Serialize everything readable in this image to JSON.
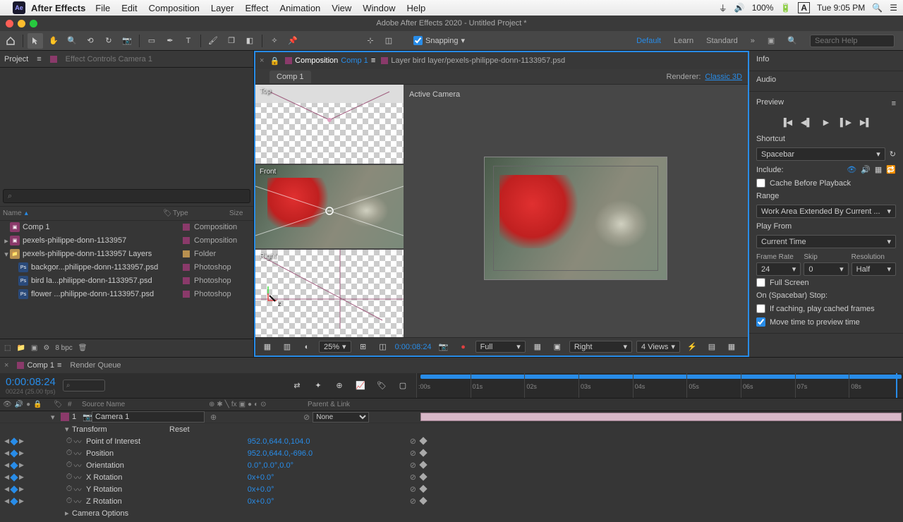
{
  "mac": {
    "app": "After Effects",
    "menus": [
      "File",
      "Edit",
      "Composition",
      "Layer",
      "Effect",
      "Animation",
      "View",
      "Window",
      "Help"
    ],
    "battery": "100%",
    "clock": "Tue 9:05 PM",
    "user_icon": "A"
  },
  "titlebar": "Adobe After Effects 2020 - Untitled Project *",
  "toolbar": {
    "snapping_label": "Snapping",
    "workspaces": [
      "Default",
      "Learn",
      "Standard"
    ],
    "search_placeholder": "Search Help"
  },
  "project": {
    "tab": "Project",
    "fx_tab": "Effect Controls Camera 1",
    "cols": {
      "name": "Name",
      "type": "Type",
      "size": "Size"
    },
    "items": [
      {
        "twirl": "",
        "indent": 0,
        "icon": "comp",
        "label": "Comp 1",
        "type": "Composition",
        "color": "#8a3a6a"
      },
      {
        "twirl": "▸",
        "indent": 0,
        "icon": "comp",
        "label": "pexels-philippe-donn-1133957",
        "type": "Composition",
        "color": "#8a3a6a"
      },
      {
        "twirl": "▾",
        "indent": 0,
        "icon": "folder",
        "label": "pexels-philippe-donn-1133957 Layers",
        "type": "Folder",
        "color": "#b89050"
      },
      {
        "twirl": "",
        "indent": 1,
        "icon": "ps",
        "label": "backgor...philippe-donn-1133957.psd",
        "type": "Photoshop",
        "color": "#8a3a6a"
      },
      {
        "twirl": "",
        "indent": 1,
        "icon": "ps",
        "label": "bird la...philippe-donn-1133957.psd",
        "type": "Photoshop",
        "color": "#8a3a6a"
      },
      {
        "twirl": "",
        "indent": 1,
        "icon": "ps",
        "label": "flower ...philippe-donn-1133957.psd",
        "type": "Photoshop",
        "color": "#8a3a6a"
      }
    ],
    "footer_bpc": "8 bpc"
  },
  "comp": {
    "tab1_prefix": "Composition",
    "tab1_name": "Comp 1",
    "tab2": "Layer bird layer/pexels-philippe-donn-1133957.psd",
    "subtab": "Comp 1",
    "renderer_label": "Renderer:",
    "renderer_value": "Classic 3D",
    "views": {
      "top": "Top",
      "front": "Front",
      "right": "Right",
      "active": "Active Camera"
    },
    "footer": {
      "zoom": "25%",
      "timecode": "0:00:08:24",
      "res": "Full",
      "viewname": "Right",
      "viewlayout": "4 Views"
    }
  },
  "right": {
    "info": "Info",
    "audio": "Audio",
    "preview": "Preview",
    "shortcut": "Shortcut",
    "shortcut_val": "Spacebar",
    "include": "Include:",
    "cache": "Cache Before Playback",
    "range": "Range",
    "range_val": "Work Area Extended By Current ...",
    "playfrom": "Play From",
    "playfrom_val": "Current Time",
    "fr_label": "Frame Rate",
    "fr_val": "24",
    "skip_label": "Skip",
    "skip_val": "0",
    "res_label": "Resolution",
    "res_val": "Half",
    "fullscreen": "Full Screen",
    "onstop": "On (Spacebar) Stop:",
    "ifcaching": "If caching, play cached frames",
    "movetime": "Move time to preview time"
  },
  "timeline": {
    "tab": "Comp 1",
    "rq": "Render Queue",
    "timecode": "0:00:08:24",
    "fps": "00224 (25.00 fps)",
    "cols": {
      "num": "#",
      "source": "Source Name",
      "parent": "Parent & Link"
    },
    "ticks": [
      ":00s",
      "01s",
      "02s",
      "03s",
      "04s",
      "05s",
      "06s",
      "07s",
      "08s"
    ],
    "layer": {
      "num": "1",
      "name": "Camera 1",
      "parent": "None"
    },
    "transform": "Transform",
    "reset": "Reset",
    "props": [
      {
        "name": "Point of Interest",
        "val": "952.0,644.0,104.0"
      },
      {
        "name": "Position",
        "val": "952.0,644.0,-696.0"
      },
      {
        "name": "Orientation",
        "val": "0.0°,0.0°,0.0°"
      },
      {
        "name": "X Rotation",
        "val": "0x+0.0°"
      },
      {
        "name": "Y Rotation",
        "val": "0x+0.0°"
      },
      {
        "name": "Z Rotation",
        "val": "0x+0.0°"
      }
    ],
    "camopts": "Camera Options"
  }
}
